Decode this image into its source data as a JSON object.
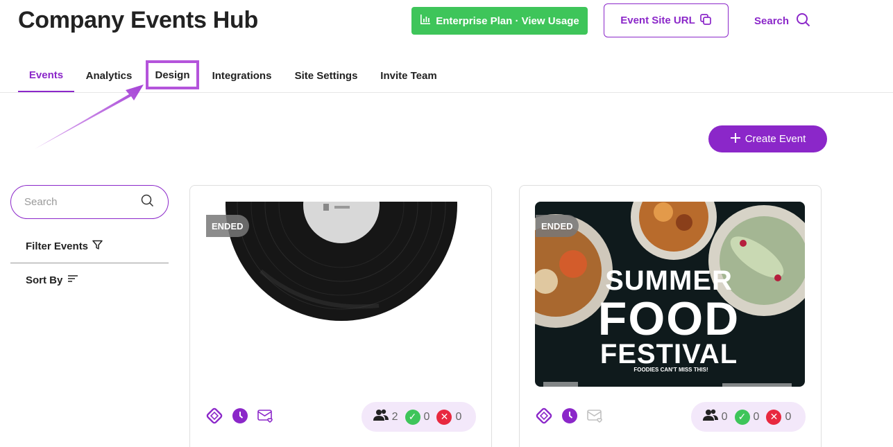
{
  "header": {
    "title": "Company Events Hub",
    "plan_label": "Enterprise Plan · View Usage",
    "site_url_label": "Event Site URL",
    "search_label": "Search"
  },
  "tabs": [
    {
      "label": "Events",
      "active": true
    },
    {
      "label": "Analytics"
    },
    {
      "label": "Design",
      "highlighted": true
    },
    {
      "label": "Integrations"
    },
    {
      "label": "Site Settings"
    },
    {
      "label": "Invite Team"
    }
  ],
  "create_event_label": "Create Event",
  "sidebar": {
    "search_placeholder": "Search",
    "filter_label": "Filter Events",
    "sort_label": "Sort By"
  },
  "events": [
    {
      "status": "ENDED",
      "image": "vinyl-record",
      "attendees": "2",
      "accepted": "0",
      "declined": "0"
    },
    {
      "status": "ENDED",
      "image": "summer-food-festival",
      "image_text": {
        "line1": "SUMMER",
        "line2": "FOOD",
        "line3": "FESTIVAL",
        "tagline": "FOODIES CAN'T MISS THIS!"
      },
      "attendees": "0",
      "accepted": "0",
      "declined": "0"
    }
  ],
  "colors": {
    "accent": "#8b27c9",
    "green": "#3ec55a",
    "red": "#e8293f",
    "highlight": "#b454db"
  }
}
